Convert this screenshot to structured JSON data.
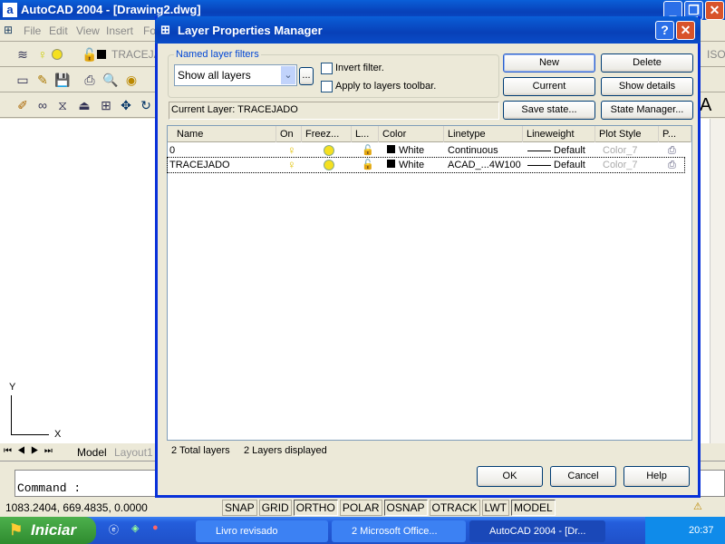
{
  "app": {
    "title": "AutoCAD 2004 - [Drawing2.dwg]",
    "menu": [
      "File",
      "Edit",
      "View",
      "Insert",
      "Fo"
    ],
    "layer_combo": "TRACEJA",
    "right_toolbar_text": "ISO-",
    "text_style_glyph": "A"
  },
  "drawing": {
    "ucs_x": "X",
    "ucs_y": "Y",
    "tabs": [
      "Model",
      "Layout1"
    ],
    "command_prompt": "Command :",
    "coords": "1083.2404, 669.4835, 0.0000",
    "status_buttons": [
      {
        "label": "SNAP",
        "on": false
      },
      {
        "label": "GRID",
        "on": false
      },
      {
        "label": "ORTHO",
        "on": true
      },
      {
        "label": "POLAR",
        "on": false
      },
      {
        "label": "OSNAP",
        "on": true
      },
      {
        "label": "OTRACK",
        "on": false
      },
      {
        "label": "LWT",
        "on": false
      },
      {
        "label": "MODEL",
        "on": true
      }
    ]
  },
  "dialog": {
    "title": "Layer Properties Manager",
    "filters_group_label": "Named layer filters",
    "filter_value": "Show all layers",
    "filter_browse": "...",
    "invert_filter": {
      "label": "Invert filter.",
      "checked": false
    },
    "apply_toolbar": {
      "label": "Apply to layers toolbar.",
      "checked": false
    },
    "buttons": {
      "new": "New",
      "delete": "Delete",
      "current": "Current",
      "show_details": "Show details",
      "save_state": "Save state...",
      "state_manager": "State Manager..."
    },
    "current_layer": "Current Layer:  TRACEJADO",
    "columns": [
      "Name",
      "On",
      "Freez...",
      "L...",
      "Color",
      "Linetype",
      "Lineweight",
      "Plot Style",
      "P..."
    ],
    "layers": [
      {
        "name": "0",
        "on": true,
        "frozen": false,
        "locked": false,
        "color": "White",
        "linetype": "Continuous",
        "lineweight": "Default",
        "plot_style": "Color_7"
      },
      {
        "name": "TRACEJADO",
        "on": true,
        "frozen": false,
        "locked": false,
        "color": "White",
        "linetype": "ACAD_...4W100",
        "lineweight": "Default",
        "plot_style": "Color_7"
      }
    ],
    "total_layers": "2 Total layers",
    "layers_displayed": "2 Layers displayed",
    "ok": "OK",
    "cancel": "Cancel",
    "help": "Help",
    "help_icon": "?"
  },
  "taskbar": {
    "start": "Iniciar",
    "items": [
      "Livro revisado",
      "2 Microsoft Office...",
      "AutoCAD 2004 - [Dr..."
    ],
    "clock": "20:37"
  },
  "colors": {
    "titlebar": "#0A5FD8",
    "taskbar": "#245EDC",
    "start": "#3C9B3C",
    "dialog_bg": "#ECE9D8",
    "close": "#D8532A"
  }
}
